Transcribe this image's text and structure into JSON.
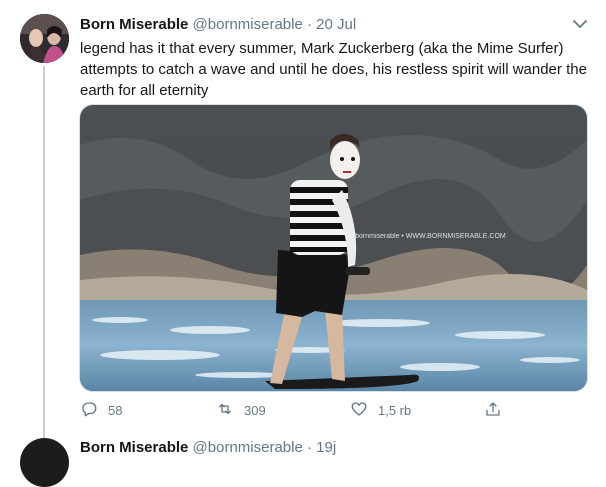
{
  "tweet": {
    "author_name": "Born Miserable",
    "author_handle": "@bornmiserable",
    "separator": "·",
    "date": "20 Jul",
    "text": "legend has it that every summer, Mark Zuckerberg (aka the Mime Surfer) attempts to catch a wave and until he does, his restless spirit will wander the earth for all eternity",
    "media": {
      "watermark": "@bornmiserable • WWW.BORNMISERABLE.COM"
    },
    "actions": {
      "reply_count": "58",
      "retweet_count": "309",
      "like_count": "1,5 rb"
    }
  },
  "next_tweet": {
    "author_name": "Born Miserable",
    "author_handle": "@bornmiserable",
    "separator": "·",
    "date": "19j"
  },
  "colors": {
    "text_primary": "#14171a",
    "text_secondary": "#657786",
    "thread_line": "#c4cfd6"
  }
}
